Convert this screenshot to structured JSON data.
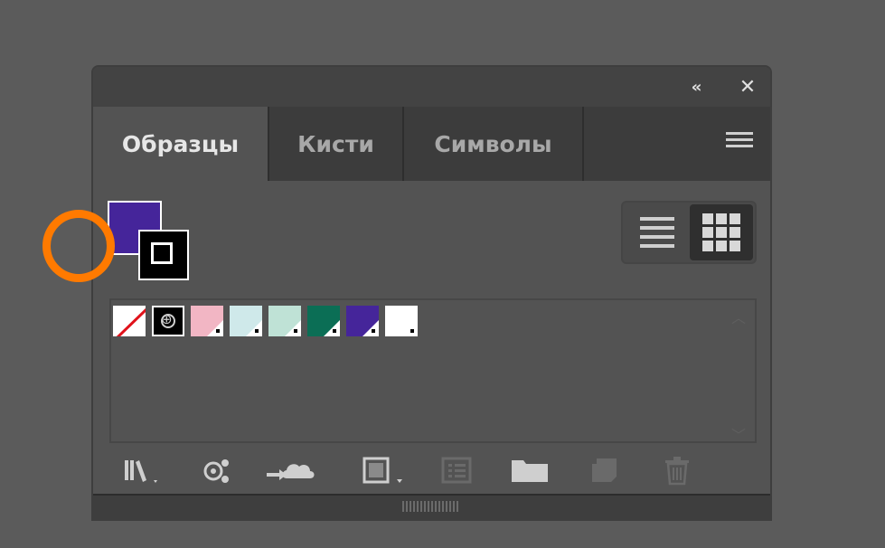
{
  "panel": {
    "tabs": [
      {
        "label": "Образцы",
        "active": true
      },
      {
        "label": "Кисти",
        "active": false
      },
      {
        "label": "Символы",
        "active": false
      }
    ],
    "fill_color": "#45259a",
    "stroke_color": "#000000"
  },
  "swatches": [
    {
      "type": "none",
      "color": "#ffffff"
    },
    {
      "type": "registration",
      "color": "#000000"
    },
    {
      "type": "color",
      "color": "#f2b6c4"
    },
    {
      "type": "color",
      "color": "#cfe9ea"
    },
    {
      "type": "color",
      "color": "#bfe2d6"
    },
    {
      "type": "color",
      "color": "#0b6e55"
    },
    {
      "type": "color",
      "color": "#45259a"
    },
    {
      "type": "color",
      "color": "#ffffff"
    }
  ],
  "highlight_color": "#ff7a00",
  "icons": {
    "collapse": "double-chevron-left-icon",
    "close": "close-icon",
    "menu": "hamburger-menu-icon",
    "list_view": "list-view-icon",
    "grid_view": "grid-view-icon",
    "library": "swatch-libraries-icon",
    "kind": "show-swatch-kinds-icon",
    "cloud": "add-to-library-icon",
    "options": "swatch-options-icon",
    "color_group": "color-group-icon",
    "new_group": "new-group-folder-icon",
    "new_swatch": "new-swatch-icon",
    "delete": "trash-icon"
  }
}
